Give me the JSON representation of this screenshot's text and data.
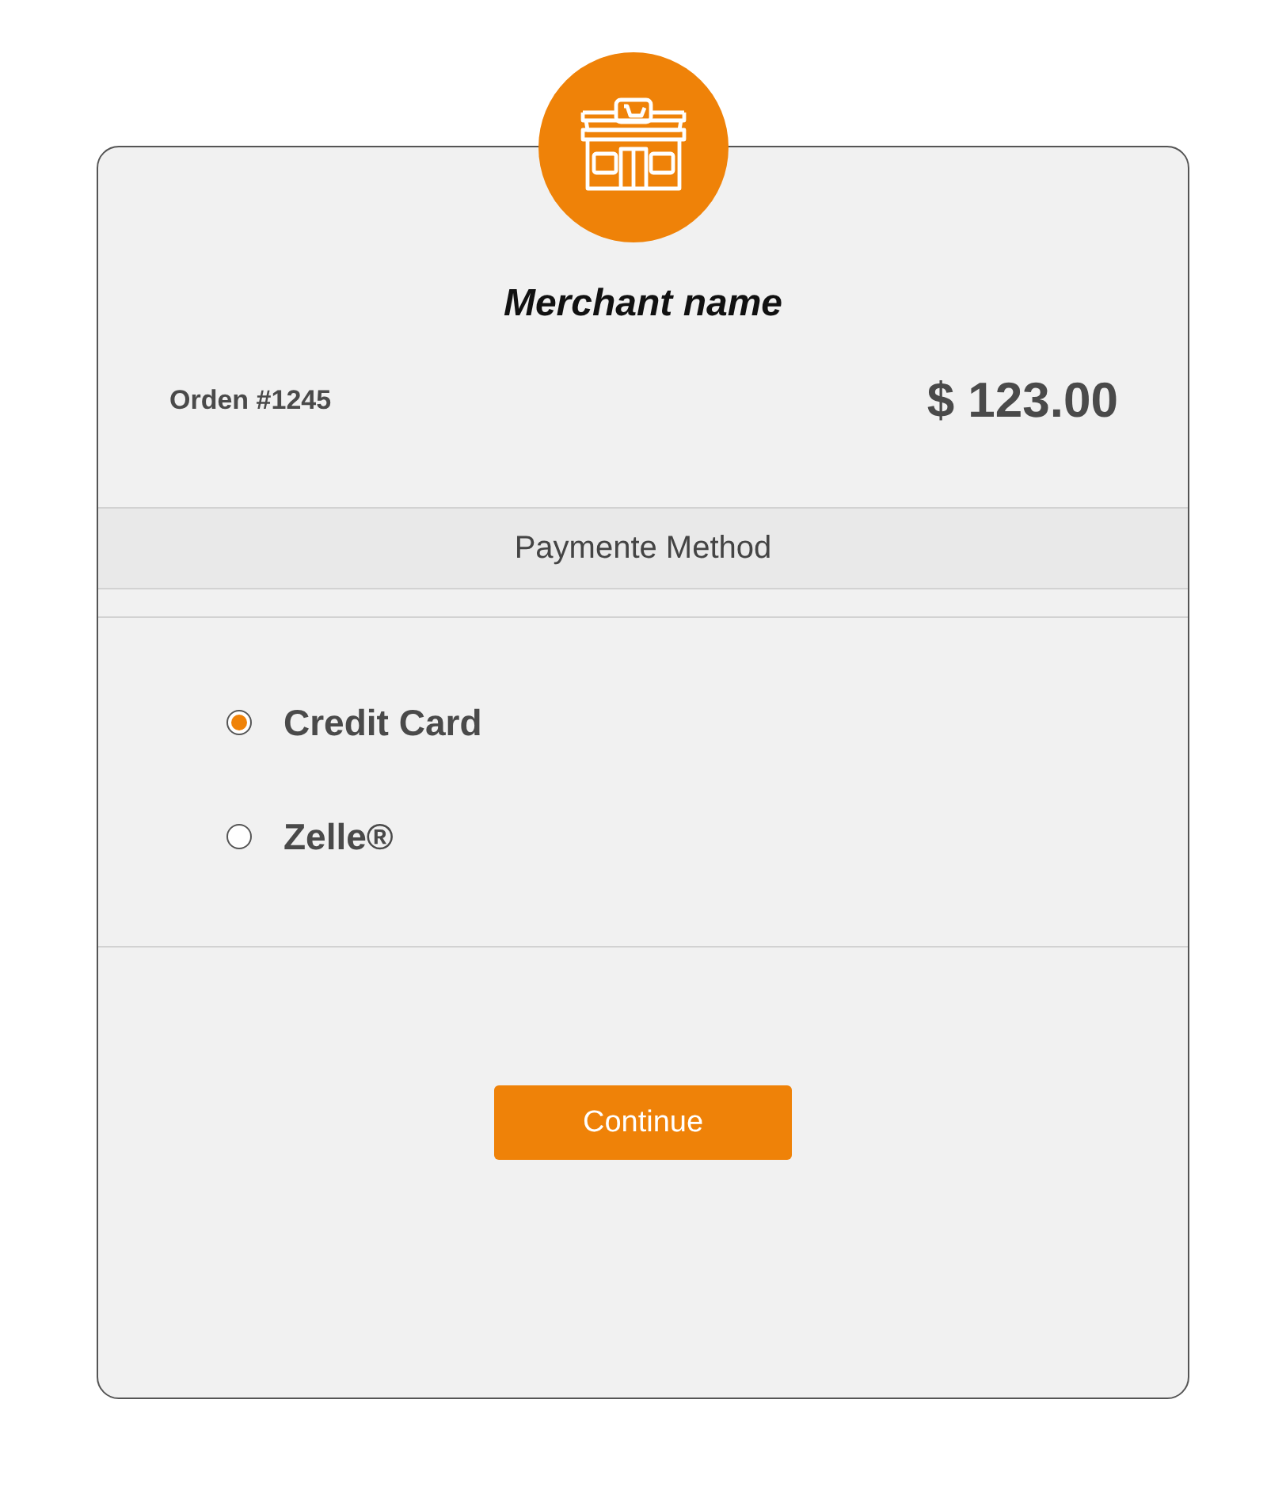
{
  "merchant": {
    "name": "Merchant name"
  },
  "order": {
    "label": "Orden #1245",
    "amount": "$ 123.00"
  },
  "section": {
    "title": "Paymente Method"
  },
  "methods": [
    {
      "label": "Credit Card",
      "selected": true
    },
    {
      "label": "Zelle®",
      "selected": false
    }
  ],
  "button": {
    "label": "Continue"
  }
}
